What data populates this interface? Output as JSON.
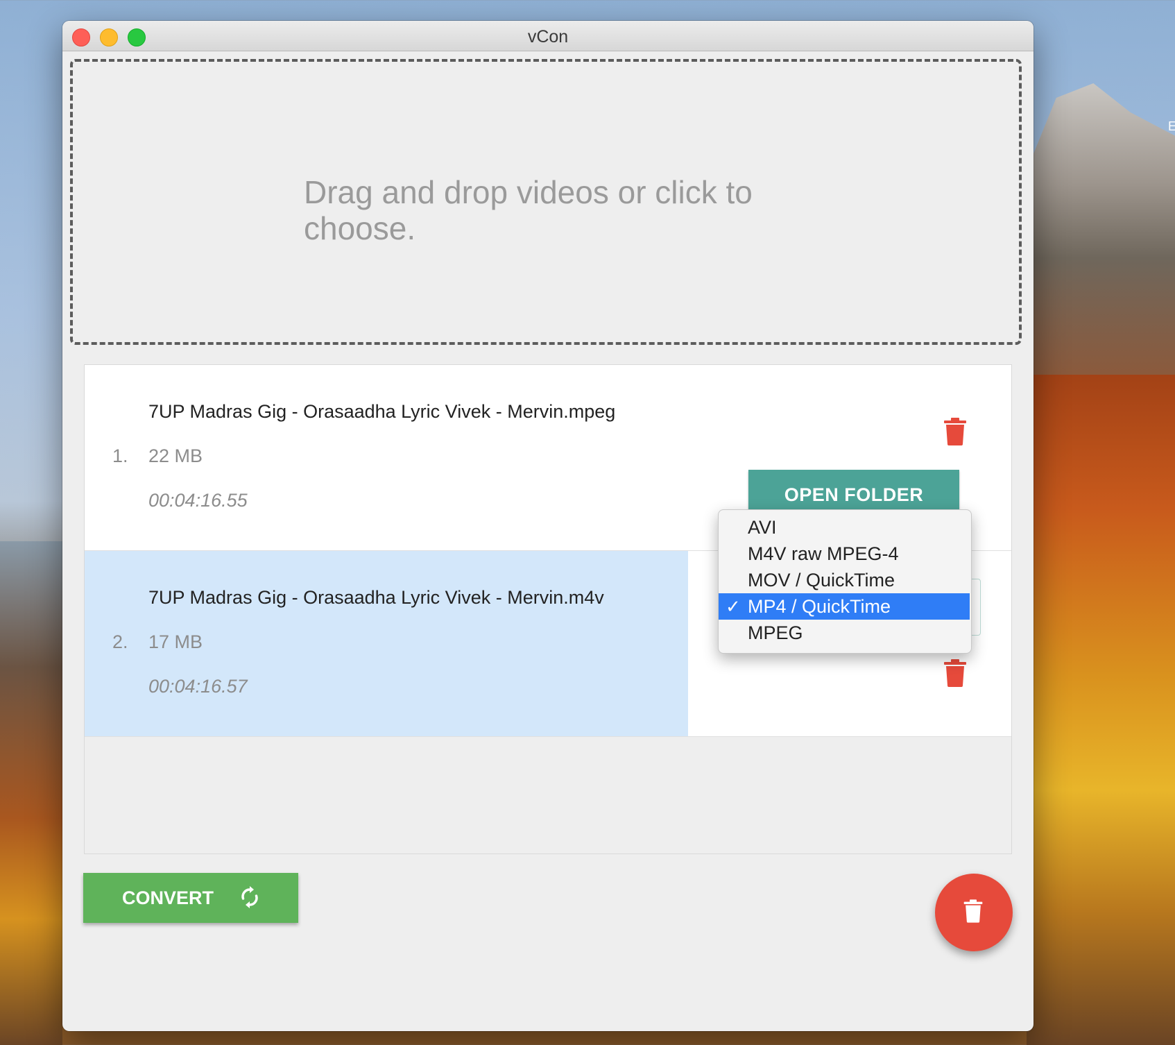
{
  "window": {
    "title": "vCon"
  },
  "dropzone": {
    "text": "Drag and drop videos or click to choose."
  },
  "files": [
    {
      "index": "1.",
      "name": "7UP Madras Gig - Orasaadha Lyric Vivek - Mervin.mpeg",
      "size": "22 MB",
      "duration": "00:04:16.55",
      "action": "OPEN FOLDER"
    },
    {
      "index": "2.",
      "name": "7UP Madras Gig - Orasaadha Lyric Vivek - Mervin.m4v",
      "size": "17 MB",
      "duration": "00:04:16.57"
    }
  ],
  "format_menu": {
    "options": [
      "AVI",
      "M4V raw MPEG-4",
      "MOV / QuickTime",
      "MP4 / QuickTime",
      "MPEG"
    ],
    "selected": "MP4 / QuickTime",
    "check": "✓"
  },
  "actions": {
    "convert": "CONVERT"
  },
  "colors": {
    "teal": "#4ca397",
    "green": "#5fb35a",
    "red": "#e64a3b",
    "select_blue": "#2f7df6",
    "row_highlight": "#d3e7fa"
  },
  "desktop": {
    "edge_glyph": "E"
  }
}
